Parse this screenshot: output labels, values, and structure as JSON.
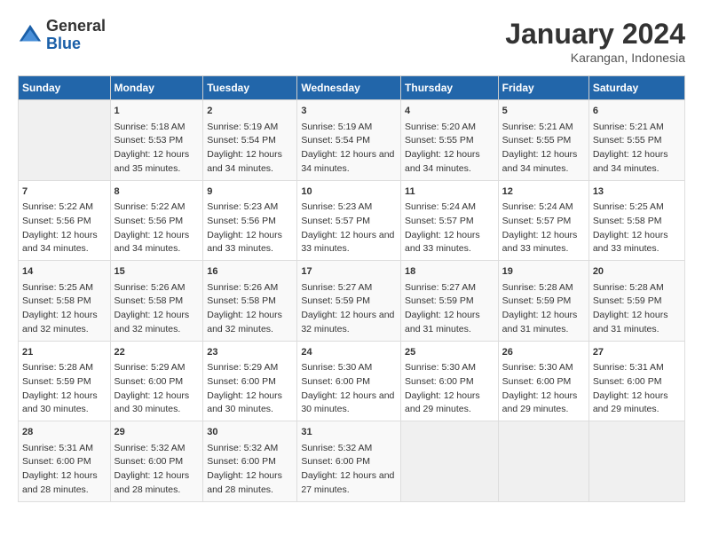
{
  "logo": {
    "general": "General",
    "blue": "Blue"
  },
  "title": "January 2024",
  "subtitle": "Karangan, Indonesia",
  "days_header": [
    "Sunday",
    "Monday",
    "Tuesday",
    "Wednesday",
    "Thursday",
    "Friday",
    "Saturday"
  ],
  "weeks": [
    [
      {
        "day": "",
        "sunrise": "",
        "sunset": "",
        "daylight": ""
      },
      {
        "day": "1",
        "sunrise": "Sunrise: 5:18 AM",
        "sunset": "Sunset: 5:53 PM",
        "daylight": "Daylight: 12 hours and 35 minutes."
      },
      {
        "day": "2",
        "sunrise": "Sunrise: 5:19 AM",
        "sunset": "Sunset: 5:54 PM",
        "daylight": "Daylight: 12 hours and 34 minutes."
      },
      {
        "day": "3",
        "sunrise": "Sunrise: 5:19 AM",
        "sunset": "Sunset: 5:54 PM",
        "daylight": "Daylight: 12 hours and 34 minutes."
      },
      {
        "day": "4",
        "sunrise": "Sunrise: 5:20 AM",
        "sunset": "Sunset: 5:55 PM",
        "daylight": "Daylight: 12 hours and 34 minutes."
      },
      {
        "day": "5",
        "sunrise": "Sunrise: 5:21 AM",
        "sunset": "Sunset: 5:55 PM",
        "daylight": "Daylight: 12 hours and 34 minutes."
      },
      {
        "day": "6",
        "sunrise": "Sunrise: 5:21 AM",
        "sunset": "Sunset: 5:55 PM",
        "daylight": "Daylight: 12 hours and 34 minutes."
      }
    ],
    [
      {
        "day": "7",
        "sunrise": "Sunrise: 5:22 AM",
        "sunset": "Sunset: 5:56 PM",
        "daylight": "Daylight: 12 hours and 34 minutes."
      },
      {
        "day": "8",
        "sunrise": "Sunrise: 5:22 AM",
        "sunset": "Sunset: 5:56 PM",
        "daylight": "Daylight: 12 hours and 34 minutes."
      },
      {
        "day": "9",
        "sunrise": "Sunrise: 5:23 AM",
        "sunset": "Sunset: 5:56 PM",
        "daylight": "Daylight: 12 hours and 33 minutes."
      },
      {
        "day": "10",
        "sunrise": "Sunrise: 5:23 AM",
        "sunset": "Sunset: 5:57 PM",
        "daylight": "Daylight: 12 hours and 33 minutes."
      },
      {
        "day": "11",
        "sunrise": "Sunrise: 5:24 AM",
        "sunset": "Sunset: 5:57 PM",
        "daylight": "Daylight: 12 hours and 33 minutes."
      },
      {
        "day": "12",
        "sunrise": "Sunrise: 5:24 AM",
        "sunset": "Sunset: 5:57 PM",
        "daylight": "Daylight: 12 hours and 33 minutes."
      },
      {
        "day": "13",
        "sunrise": "Sunrise: 5:25 AM",
        "sunset": "Sunset: 5:58 PM",
        "daylight": "Daylight: 12 hours and 33 minutes."
      }
    ],
    [
      {
        "day": "14",
        "sunrise": "Sunrise: 5:25 AM",
        "sunset": "Sunset: 5:58 PM",
        "daylight": "Daylight: 12 hours and 32 minutes."
      },
      {
        "day": "15",
        "sunrise": "Sunrise: 5:26 AM",
        "sunset": "Sunset: 5:58 PM",
        "daylight": "Daylight: 12 hours and 32 minutes."
      },
      {
        "day": "16",
        "sunrise": "Sunrise: 5:26 AM",
        "sunset": "Sunset: 5:58 PM",
        "daylight": "Daylight: 12 hours and 32 minutes."
      },
      {
        "day": "17",
        "sunrise": "Sunrise: 5:27 AM",
        "sunset": "Sunset: 5:59 PM",
        "daylight": "Daylight: 12 hours and 32 minutes."
      },
      {
        "day": "18",
        "sunrise": "Sunrise: 5:27 AM",
        "sunset": "Sunset: 5:59 PM",
        "daylight": "Daylight: 12 hours and 31 minutes."
      },
      {
        "day": "19",
        "sunrise": "Sunrise: 5:28 AM",
        "sunset": "Sunset: 5:59 PM",
        "daylight": "Daylight: 12 hours and 31 minutes."
      },
      {
        "day": "20",
        "sunrise": "Sunrise: 5:28 AM",
        "sunset": "Sunset: 5:59 PM",
        "daylight": "Daylight: 12 hours and 31 minutes."
      }
    ],
    [
      {
        "day": "21",
        "sunrise": "Sunrise: 5:28 AM",
        "sunset": "Sunset: 5:59 PM",
        "daylight": "Daylight: 12 hours and 30 minutes."
      },
      {
        "day": "22",
        "sunrise": "Sunrise: 5:29 AM",
        "sunset": "Sunset: 6:00 PM",
        "daylight": "Daylight: 12 hours and 30 minutes."
      },
      {
        "day": "23",
        "sunrise": "Sunrise: 5:29 AM",
        "sunset": "Sunset: 6:00 PM",
        "daylight": "Daylight: 12 hours and 30 minutes."
      },
      {
        "day": "24",
        "sunrise": "Sunrise: 5:30 AM",
        "sunset": "Sunset: 6:00 PM",
        "daylight": "Daylight: 12 hours and 30 minutes."
      },
      {
        "day": "25",
        "sunrise": "Sunrise: 5:30 AM",
        "sunset": "Sunset: 6:00 PM",
        "daylight": "Daylight: 12 hours and 29 minutes."
      },
      {
        "day": "26",
        "sunrise": "Sunrise: 5:30 AM",
        "sunset": "Sunset: 6:00 PM",
        "daylight": "Daylight: 12 hours and 29 minutes."
      },
      {
        "day": "27",
        "sunrise": "Sunrise: 5:31 AM",
        "sunset": "Sunset: 6:00 PM",
        "daylight": "Daylight: 12 hours and 29 minutes."
      }
    ],
    [
      {
        "day": "28",
        "sunrise": "Sunrise: 5:31 AM",
        "sunset": "Sunset: 6:00 PM",
        "daylight": "Daylight: 12 hours and 28 minutes."
      },
      {
        "day": "29",
        "sunrise": "Sunrise: 5:32 AM",
        "sunset": "Sunset: 6:00 PM",
        "daylight": "Daylight: 12 hours and 28 minutes."
      },
      {
        "day": "30",
        "sunrise": "Sunrise: 5:32 AM",
        "sunset": "Sunset: 6:00 PM",
        "daylight": "Daylight: 12 hours and 28 minutes."
      },
      {
        "day": "31",
        "sunrise": "Sunrise: 5:32 AM",
        "sunset": "Sunset: 6:00 PM",
        "daylight": "Daylight: 12 hours and 27 minutes."
      },
      {
        "day": "",
        "sunrise": "",
        "sunset": "",
        "daylight": ""
      },
      {
        "day": "",
        "sunrise": "",
        "sunset": "",
        "daylight": ""
      },
      {
        "day": "",
        "sunrise": "",
        "sunset": "",
        "daylight": ""
      }
    ]
  ]
}
